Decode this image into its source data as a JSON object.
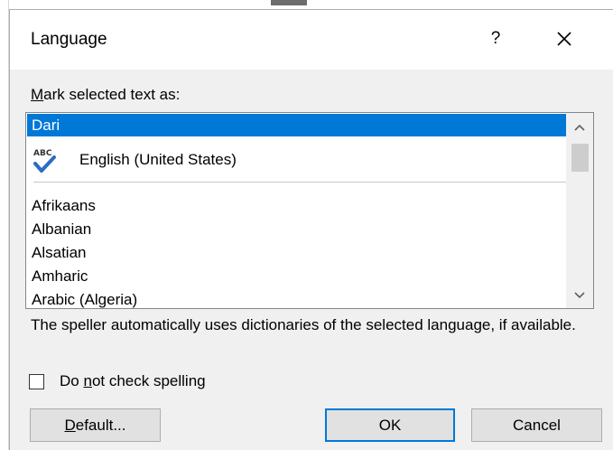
{
  "dialog": {
    "title": "Language",
    "help_label": "?",
    "mark_label_first": "M",
    "mark_label_rest": "ark selected text as:",
    "list": {
      "selected": "Dari",
      "proofing_item": "English (United States)",
      "proofing_icon": "abc-spellcheck-icon",
      "items": [
        "Afrikaans",
        "Albanian",
        "Alsatian",
        "Amharic",
        "Arabic (Algeria)"
      ]
    },
    "info_text": "The speller automatically uses dictionaries of the selected language, if available.",
    "checkbox": {
      "label_before": "Do ",
      "label_ul": "n",
      "label_after": "ot check spelling",
      "checked": false
    },
    "buttons": {
      "default_ul": "D",
      "default_rest": "efault...",
      "ok": "OK",
      "cancel": "Cancel"
    },
    "colors": {
      "selection": "#0078d7",
      "dialog_bg": "#f0f0f0"
    }
  }
}
